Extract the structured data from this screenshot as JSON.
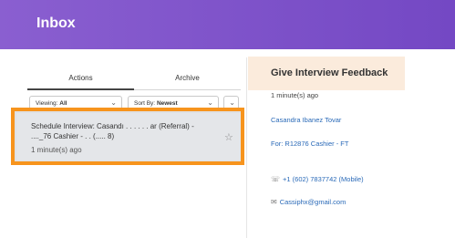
{
  "header": {
    "title": "Inbox"
  },
  "tabs": [
    {
      "label": "Actions",
      "active": true
    },
    {
      "label": "Archive",
      "active": false
    }
  ],
  "filters": {
    "viewing_label": "Viewing:",
    "viewing_value": "All",
    "sort_label": "Sort By:",
    "sort_value": "Newest"
  },
  "inbox_items": [
    {
      "line1": "Schedule Interview: Casandı . . . . . . ar (Referral) -",
      "line2": "...._76 Cashier - . . (..... 8)",
      "time": "1 minute(s) ago"
    }
  ],
  "detail": {
    "title": "Give Interview Feedback",
    "time": "1 minute(s) ago",
    "candidate": "Casandra Ibanez Tovar",
    "requisition": "For: R12876 Cashier - FT",
    "phone": "+1 (602) 7837742 (Mobile)",
    "email": "Cassiphx@gmail.com"
  },
  "icons": {
    "phone": "phone-icon",
    "email": "envelope-icon",
    "star": "star-icon",
    "chevron": "chevron-down-icon"
  },
  "colors": {
    "header_bg": "#7a4fc8",
    "highlight": "#f7941d",
    "detail_header_bg": "#fbebdc",
    "link": "#2a6ab8"
  }
}
